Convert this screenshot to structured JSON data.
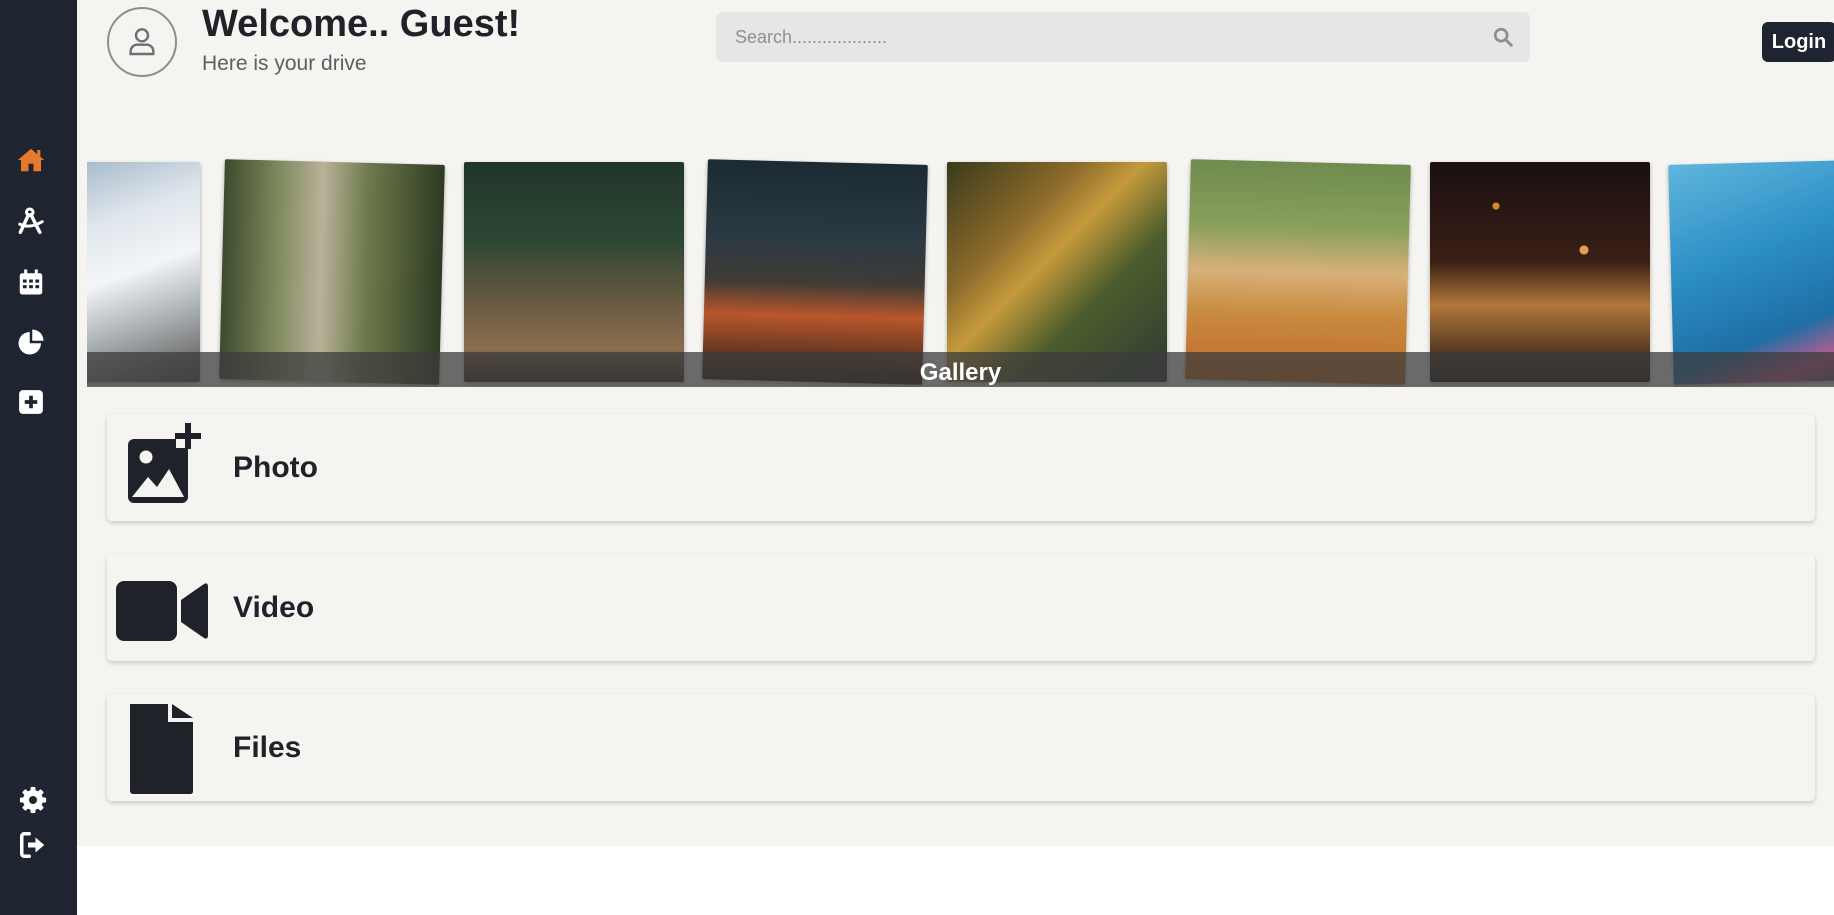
{
  "header": {
    "welcome": "Welcome.. Guest!",
    "subtitle": "Here is your drive",
    "search_placeholder": "Search...................",
    "login_label": "Login"
  },
  "sidebar": {
    "items": [
      {
        "name": "home",
        "icon": "home-icon",
        "active": true
      },
      {
        "name": "tools",
        "icon": "compass-drafting-icon",
        "active": false
      },
      {
        "name": "calendar",
        "icon": "calendar-icon",
        "active": false
      },
      {
        "name": "stats",
        "icon": "pie-chart-icon",
        "active": false
      },
      {
        "name": "add",
        "icon": "plus-square-icon",
        "active": false
      }
    ],
    "bottom_items": [
      {
        "name": "settings",
        "icon": "gear-icon"
      },
      {
        "name": "logout",
        "icon": "logout-icon"
      }
    ],
    "active_color": "#e8792b",
    "icon_color": "#ffffff",
    "background": "#1f2431"
  },
  "gallery": {
    "label": "Gallery"
  },
  "categories": [
    {
      "label": "Photo",
      "icon": "add-image-icon"
    },
    {
      "label": "Video",
      "icon": "video-camera-icon"
    },
    {
      "label": "Files",
      "icon": "file-icon"
    }
  ]
}
